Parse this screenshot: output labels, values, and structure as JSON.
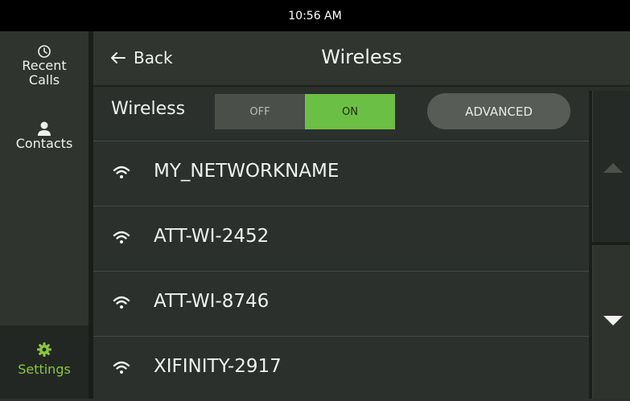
{
  "status_bar": {
    "time": "10:56 AM"
  },
  "sidebar": {
    "items": [
      {
        "label_line1": "Recent",
        "label_line2": "Calls",
        "icon": "clock-icon"
      },
      {
        "label": "Contacts",
        "icon": "person-icon"
      },
      {
        "label": "Settings",
        "icon": "gear-icon",
        "active": true
      }
    ]
  },
  "header": {
    "back_label": "Back",
    "title": "Wireless"
  },
  "wireless": {
    "label": "Wireless",
    "toggle_off": "OFF",
    "toggle_on": "ON",
    "state": "ON",
    "advanced_label": "ADVANCED"
  },
  "networks": [
    {
      "name": "MY_NETWORKNAME"
    },
    {
      "name": "ATT-WI-2452"
    },
    {
      "name": "ATT-WI-8746"
    },
    {
      "name": "XIFINITY-2917"
    }
  ],
  "colors": {
    "accent": "#6cbf45",
    "background": "#2b302c",
    "status_bar": "#000000"
  }
}
